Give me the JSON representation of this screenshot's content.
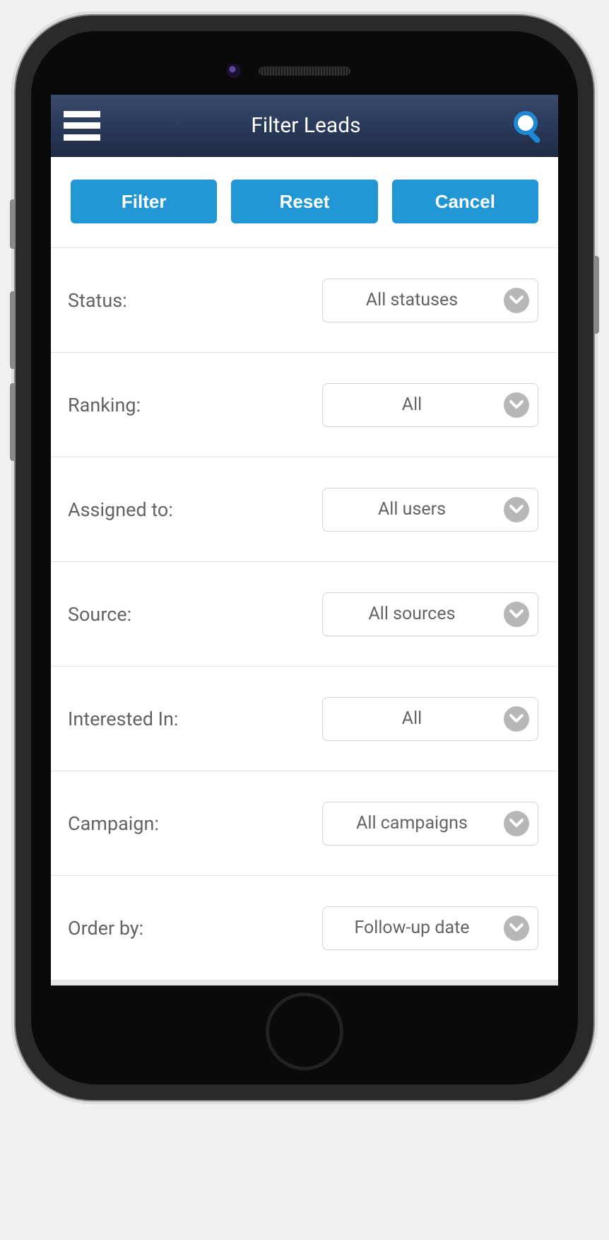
{
  "header": {
    "title": "Filter Leads"
  },
  "actions": {
    "filter": "Filter",
    "reset": "Reset",
    "cancel": "Cancel"
  },
  "filters": {
    "status": {
      "label": "Status:",
      "value": "All statuses"
    },
    "ranking": {
      "label": "Ranking:",
      "value": "All"
    },
    "assigned_to": {
      "label": "Assigned to:",
      "value": "All users"
    },
    "source": {
      "label": "Source:",
      "value": "All sources"
    },
    "interested": {
      "label": "Interested In:",
      "value": "All"
    },
    "campaign": {
      "label": "Campaign:",
      "value": "All campaigns"
    },
    "order_by": {
      "label": "Order by:",
      "value": "Follow-up date"
    }
  },
  "colors": {
    "accent": "#2196d4",
    "header_top": "#3a4a6b",
    "header_bottom": "#1f2c44",
    "text_muted": "#636363"
  }
}
